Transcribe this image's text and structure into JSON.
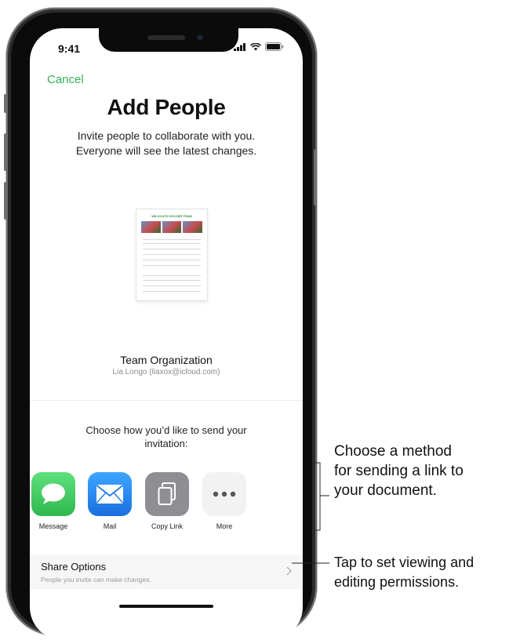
{
  "status": {
    "time": "9:41"
  },
  "header": {
    "cancel_label": "Cancel",
    "title": "Add People"
  },
  "description": {
    "line1": "Invite people to collaborate with you.",
    "line2": "Everyone will see the latest changes."
  },
  "document": {
    "thumbnail_title": "WILDCATS SOCCER TEAM",
    "name": "Team Organization",
    "owner": "Lia Longo (liaxox@icloud.com)"
  },
  "send": {
    "prompt_line1": "Choose how you’d like to send your",
    "prompt_line2": "invitation:",
    "options": [
      {
        "label": "Message",
        "icon": "message-icon",
        "color": "#34c759"
      },
      {
        "label": "Mail",
        "icon": "mail-icon",
        "color": "#1e86f2"
      },
      {
        "label": "Copy Link",
        "icon": "copy-link-icon",
        "color": "#8e8e93"
      },
      {
        "label": "More",
        "icon": "more-icon",
        "color": "#f2f2f2"
      }
    ]
  },
  "share_options": {
    "title": "Share Options",
    "subtitle": "People you invite can make changes."
  },
  "callouts": {
    "method_line1": "Choose a method",
    "method_line2": "for sending a link to",
    "method_line3": "your document.",
    "permissions_line1": "Tap to set viewing and",
    "permissions_line2": "editing permissions."
  },
  "colors": {
    "accent": "#34b05a"
  }
}
